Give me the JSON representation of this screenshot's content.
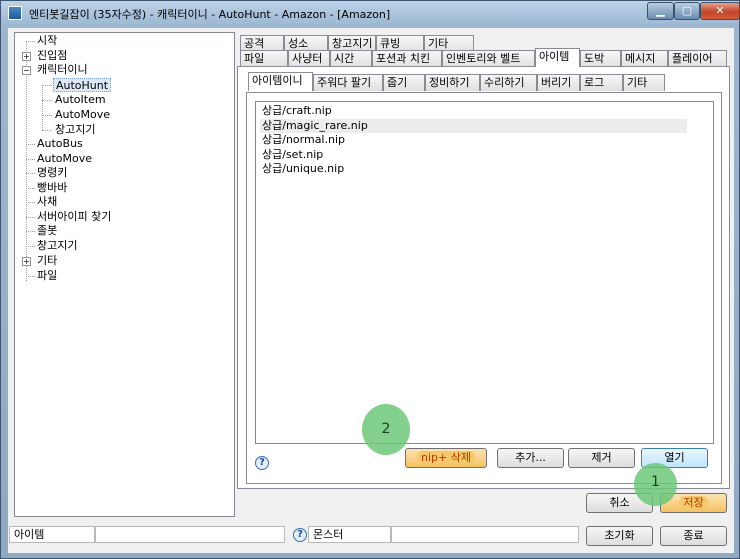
{
  "window": {
    "title": "엔티봇길잡이 (35자수정) - 캐릭터이니 - AutoHunt - Amazon - [Amazon]",
    "min_label": "▁",
    "max_label": "▢",
    "close_label": "✕"
  },
  "tree": {
    "items": [
      {
        "label": "시작"
      },
      {
        "label": "진입점",
        "expander": "+"
      },
      {
        "label": "캐릭터이니",
        "expander": "−"
      },
      {
        "label": "AutoHunt"
      },
      {
        "label": "AutoItem"
      },
      {
        "label": "AutoMove"
      },
      {
        "label": "창고지기"
      },
      {
        "label": "AutoBus"
      },
      {
        "label": "AutoMove"
      },
      {
        "label": "명령키"
      },
      {
        "label": "빵바바"
      },
      {
        "label": "사채"
      },
      {
        "label": "서버아이피 찾기"
      },
      {
        "label": "졸봇"
      },
      {
        "label": "창고지기"
      },
      {
        "label": "기타",
        "expander": "+"
      },
      {
        "label": "파일"
      }
    ]
  },
  "tabs": {
    "row1": [
      "공격",
      "성소",
      "창고지기",
      "큐빙",
      "기타"
    ],
    "row2": [
      "파일",
      "사냥터",
      "시간",
      "포션과 치킨",
      "인벤토리와 벨트",
      "아이템",
      "도박",
      "메시지",
      "플레이어"
    ],
    "row2_active": "아이템",
    "sub": [
      "아이템이니",
      "주워다 팔기",
      "줍기",
      "정비하기",
      "수리하기",
      "버리기",
      "로그",
      "기타"
    ],
    "sub_active": "아이템이니"
  },
  "nip_list": [
    "상급/craft.nip",
    "상급/magic_rare.nip",
    "상급/normal.nip",
    "상급/set.nip",
    "상급/unique.nip"
  ],
  "panel_buttons": {
    "help": "?",
    "delete": "nip+ 삭제",
    "add": "추가...",
    "remove": "제거",
    "open": "열기"
  },
  "dialog_buttons": {
    "cancel": "취소",
    "save": "저장",
    "reset": "초기화",
    "exit": "종료"
  },
  "status": {
    "field1": "아이템",
    "help": "?",
    "field2": "몬스터"
  },
  "markers": {
    "one": "1",
    "two": "2"
  },
  "colors": {
    "marker": "#6cc878",
    "selection": "#dfe9f5",
    "accent": "#3c7fb1"
  }
}
